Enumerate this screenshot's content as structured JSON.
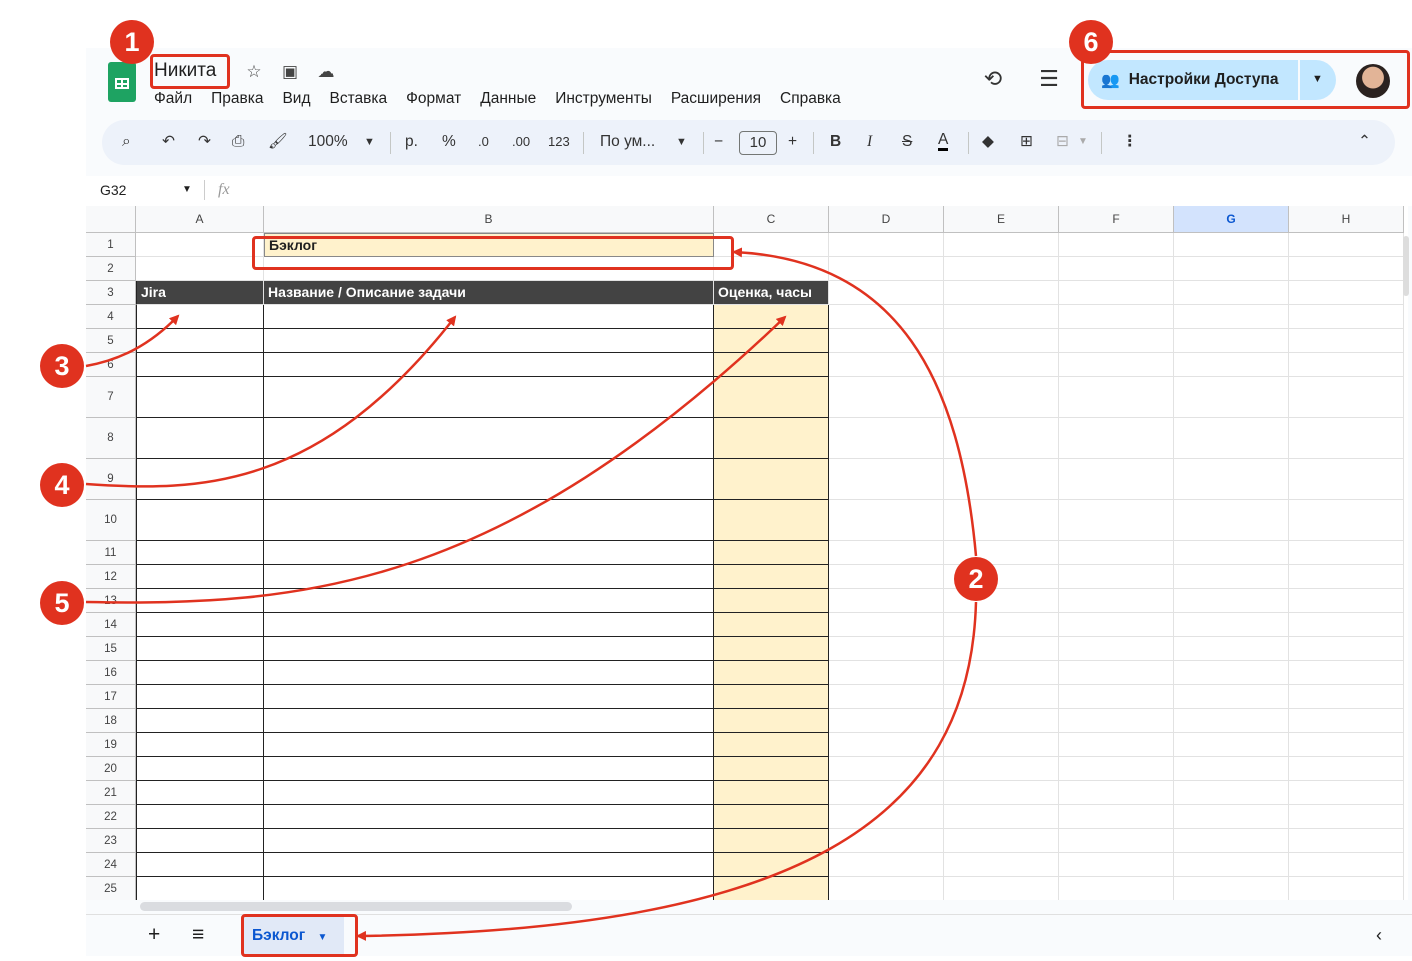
{
  "doc": {
    "title": "Никита"
  },
  "menu": [
    "Файл",
    "Правка",
    "Вид",
    "Вставка",
    "Формат",
    "Данные",
    "Инструменты",
    "Расширения",
    "Справка"
  ],
  "share": {
    "label": "Настройки Доступа"
  },
  "toolbar": {
    "zoom": "100%",
    "currency": "р.",
    "percent": "%",
    "dec_less": ".0",
    "dec_more": ".00",
    "format_123": "123",
    "font": "По ум...",
    "font_size": "10",
    "bold": "B",
    "italic": "I",
    "text_color": "A"
  },
  "namebox": {
    "ref": "G32",
    "fx": "fx"
  },
  "columns": [
    "A",
    "B",
    "C",
    "D",
    "E",
    "F",
    "G",
    "H"
  ],
  "selected_column": "G",
  "rows": [
    "1",
    "2",
    "3",
    "4",
    "5",
    "6",
    "7",
    "8",
    "9",
    "10",
    "11",
    "12",
    "13",
    "14",
    "15",
    "16",
    "17",
    "18",
    "19",
    "20",
    "21",
    "22",
    "23",
    "24",
    "25"
  ],
  "sheet": {
    "title_cell": "Бэклог",
    "headers": {
      "a": "Jira",
      "b": "Название / Описание задачи",
      "c": "Оценка, часы"
    }
  },
  "tabs": {
    "add": "+",
    "list": "≡",
    "active": "Бэклог"
  },
  "annotations": [
    "1",
    "2",
    "3",
    "4",
    "5",
    "6"
  ],
  "colors": {
    "accent": "#e0321f",
    "header_fill": "#434343",
    "highlight": "#fff2cc",
    "share_bg": "#c2e7ff"
  }
}
